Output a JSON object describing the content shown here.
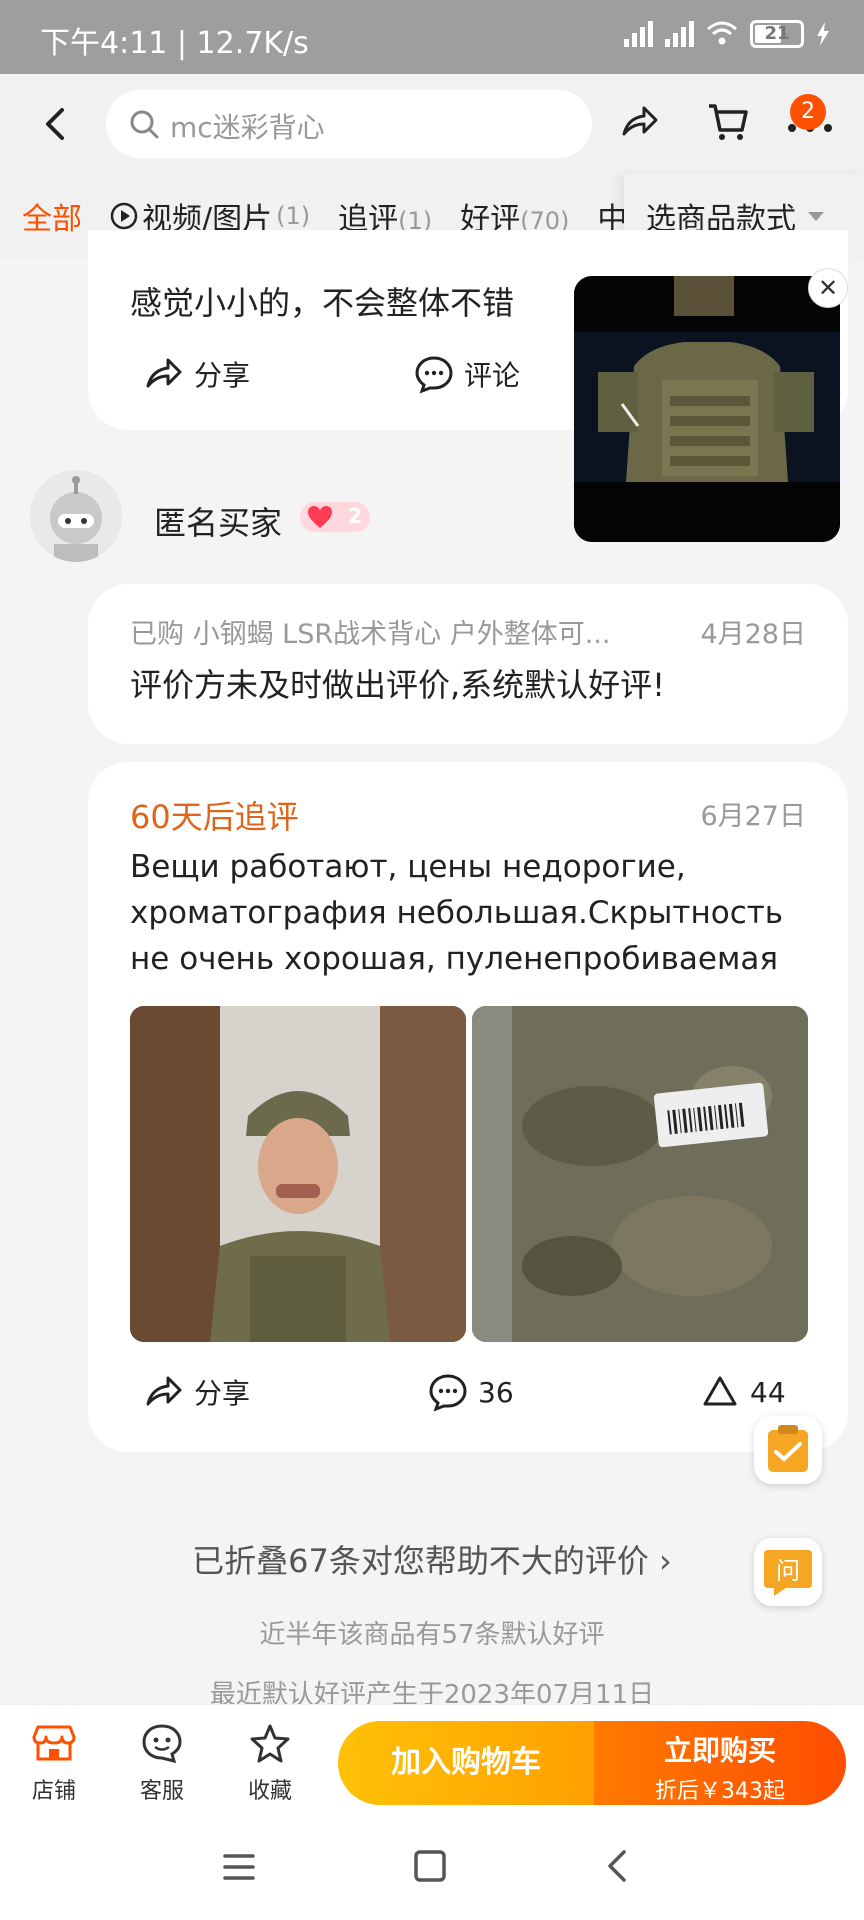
{
  "status": {
    "time": "下午4:11 | 12.7K/s",
    "battery": "21"
  },
  "search": {
    "placeholder": "mc迷彩背心"
  },
  "cart_badge": "2",
  "tabs": [
    {
      "label": "全部",
      "count": ""
    },
    {
      "label": "视频/图片",
      "count": "(1)"
    },
    {
      "label": "追评",
      "count": "(1)"
    },
    {
      "label": "好评",
      "count": "(70)"
    },
    {
      "label": "中",
      "count": ""
    }
  ],
  "select_style": "选商品款式",
  "review_top": {
    "text": "感觉小小的，不会整体不错",
    "share": "分享",
    "comment": "评论"
  },
  "user": {
    "name": "匿名买家",
    "level": "2"
  },
  "review_main": {
    "bought": "已购 小钢蝎 LSR战术背心 户外整体可...",
    "date": "4月28日",
    "text": "评价方未及时做出评价,系统默认好评!"
  },
  "followup": {
    "label": "60天后追评",
    "date": "6月27日",
    "text": "Вещи работают, цены недорогие, хроматография небольшая.Скрытность не очень хорошая, пуленепробиваемая",
    "share": "分享",
    "comments": "36",
    "likes": "44"
  },
  "folded": "已折叠67条对您帮助不大的评价 ›",
  "note1": "近半年该商品有57条默认好评",
  "note2": "最近默认好评产生于2023年07月11日",
  "bottom": {
    "store": "店铺",
    "service": "客服",
    "favorite": "收藏",
    "add_cart": "加入购物车",
    "buy_now": "立即购买",
    "price_note": "折后￥343起"
  },
  "colors": {
    "accent": "#ff5000",
    "followup": "#e0651a"
  }
}
